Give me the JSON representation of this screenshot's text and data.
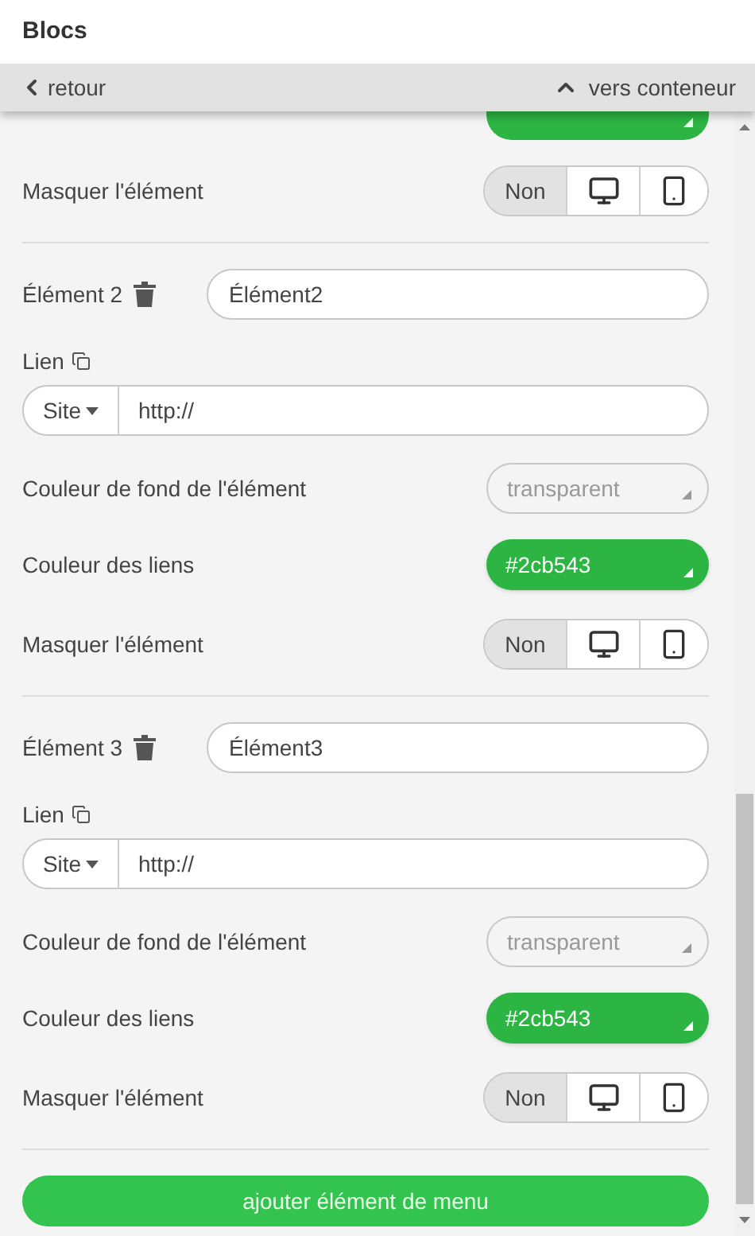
{
  "header": {
    "title": "Blocs"
  },
  "nav": {
    "back": "retour",
    "up": "vers conteneur"
  },
  "partial": {
    "hide_label": "Masquer l'élément",
    "hide_options": [
      {
        "kind": "text",
        "label": "Non",
        "selected": true
      },
      {
        "kind": "desktop",
        "selected": false
      },
      {
        "kind": "mobile",
        "selected": false
      }
    ]
  },
  "elements": [
    {
      "title": "Élément 2",
      "name": "Élément2",
      "link_label": "Lien",
      "site_select": "Site",
      "url": "http://",
      "bg_label": "Couleur de fond de l'élément",
      "bg_value": "transparent",
      "link_color_label": "Couleur des liens",
      "link_color": "#2cb543",
      "hide_label": "Masquer l'élément",
      "hide_options": [
        {
          "kind": "text",
          "label": "Non",
          "selected": true
        },
        {
          "kind": "desktop",
          "selected": false
        },
        {
          "kind": "mobile",
          "selected": false
        }
      ]
    },
    {
      "title": "Élément 3",
      "name": "Élément3",
      "link_label": "Lien",
      "site_select": "Site",
      "url": "http://",
      "bg_label": "Couleur de fond de l'élément",
      "bg_value": "transparent",
      "link_color_label": "Couleur des liens",
      "link_color": "#2cb543",
      "hide_label": "Masquer l'élément",
      "hide_options": [
        {
          "kind": "text",
          "label": "Non",
          "selected": true
        },
        {
          "kind": "desktop",
          "selected": false
        },
        {
          "kind": "mobile",
          "selected": false
        }
      ]
    }
  ],
  "add_button": "ajouter élément de menu"
}
